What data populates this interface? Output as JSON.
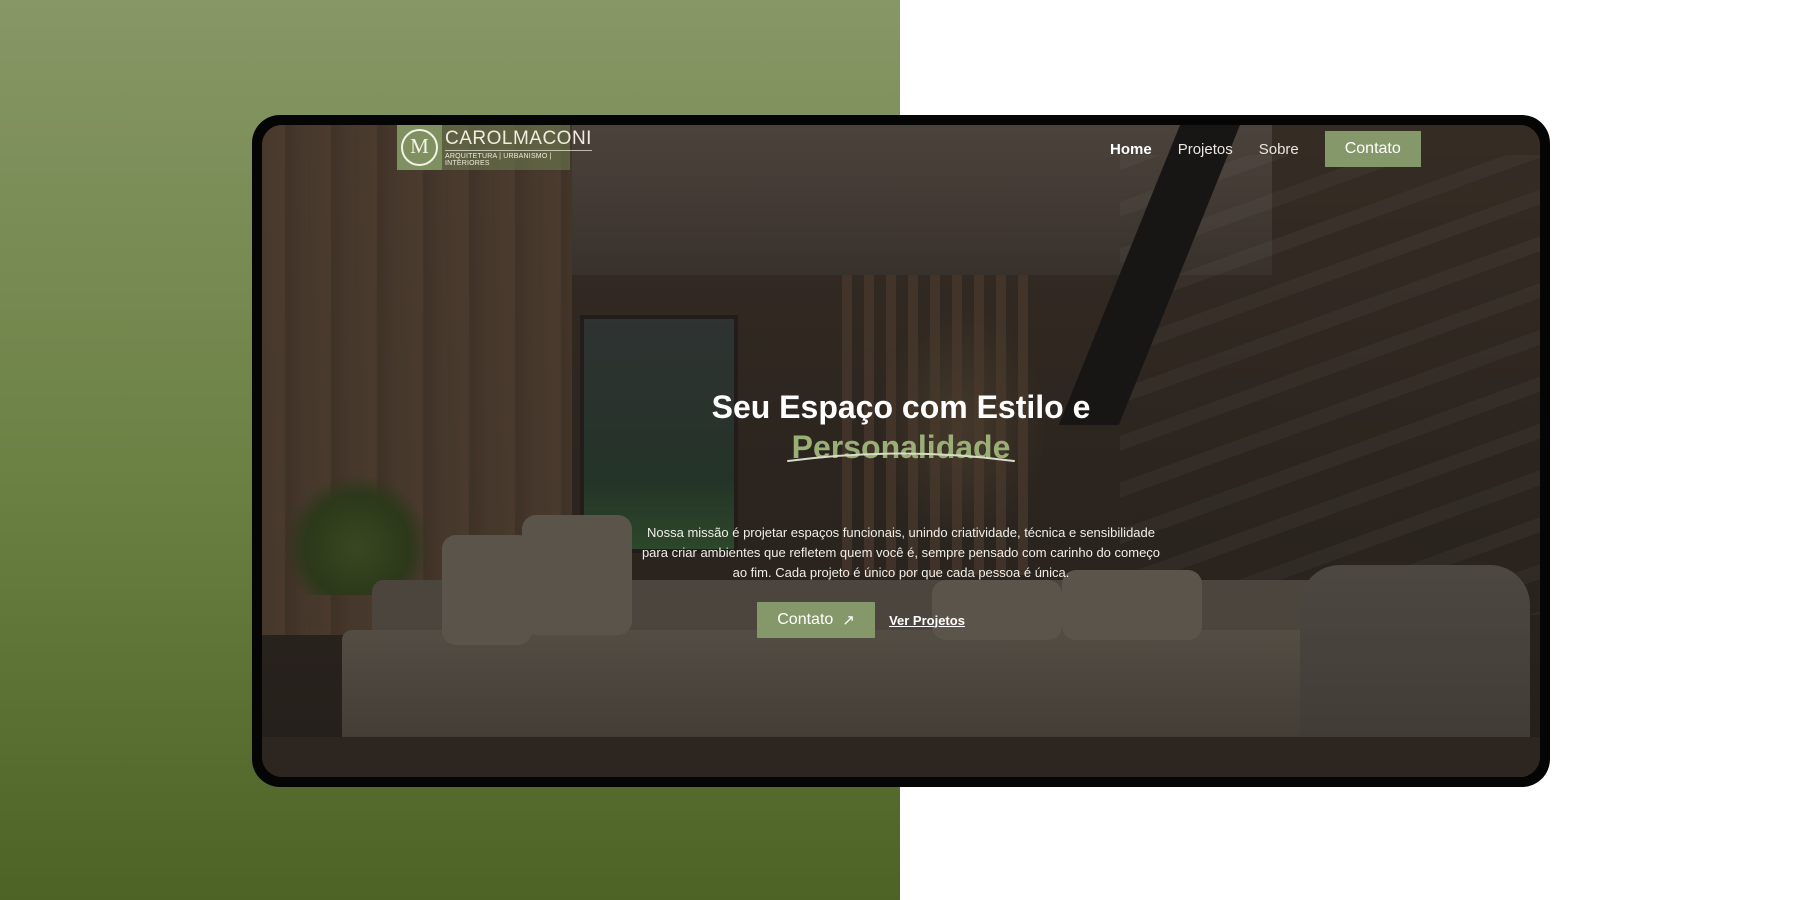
{
  "brand": {
    "name": "CAROLMACONI",
    "tagline": "ARQUITETURA | URBANISMO | INTERIORES",
    "monogram": "M"
  },
  "nav": {
    "links": [
      {
        "label": "Home",
        "active": true
      },
      {
        "label": "Projetos",
        "active": false
      },
      {
        "label": "Sobre",
        "active": false
      }
    ],
    "cta_label": "Contato"
  },
  "hero": {
    "title_line1": "Seu Espaço com Estilo e",
    "title_accent": "Personalidade",
    "description": "Nossa missão é projetar espaços funcionais, unindo criatividade, técnica e sensibilidade para criar ambientes que refletem quem você é, sempre pensado com carinho do começo ao fim. Cada projeto é único por que cada pessoa é única.",
    "primary_button": "Contato",
    "primary_button_icon": "arrow-up-right-icon",
    "secondary_link": "Ver Projetos"
  },
  "colors": {
    "accent": "#84986a",
    "accent_text": "#9aaf76",
    "background_gradient_top": "#879766",
    "background_gradient_bottom": "#4d6325"
  }
}
